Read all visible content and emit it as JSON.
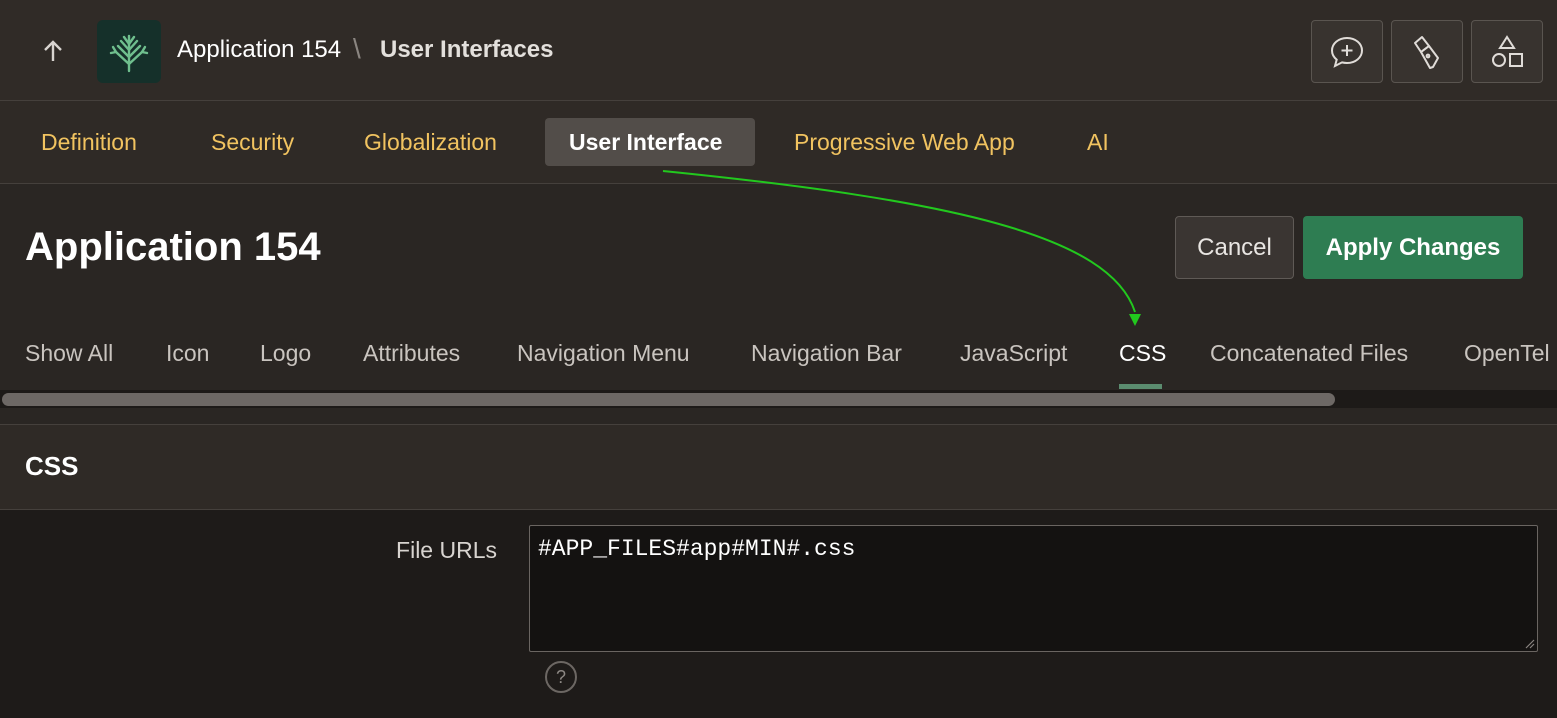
{
  "header": {
    "up_icon": "arrow-up-icon",
    "logo_icon": "tree-logo-icon",
    "app_name": "Application 154",
    "separator": "\\",
    "current_page": "User Interfaces",
    "tools": [
      "add-comment-icon",
      "flashlight-icon",
      "shapes-icon"
    ]
  },
  "nav": {
    "tabs": [
      {
        "label": "Definition",
        "active": false
      },
      {
        "label": "Security",
        "active": false
      },
      {
        "label": "Globalization",
        "active": false
      },
      {
        "label": "User Interface",
        "active": true
      },
      {
        "label": "Progressive Web App",
        "active": false
      },
      {
        "label": "AI",
        "active": false
      }
    ]
  },
  "page": {
    "title": "Application 154",
    "cancel_label": "Cancel",
    "apply_label": "Apply Changes"
  },
  "subtabs": [
    {
      "label": "Show All",
      "active": false
    },
    {
      "label": "Icon",
      "active": false
    },
    {
      "label": "Logo",
      "active": false
    },
    {
      "label": "Attributes",
      "active": false
    },
    {
      "label": "Navigation Menu",
      "active": false
    },
    {
      "label": "Navigation Bar",
      "active": false
    },
    {
      "label": "JavaScript",
      "active": false
    },
    {
      "label": "CSS",
      "active": true
    },
    {
      "label": "Concatenated Files",
      "active": false
    },
    {
      "label": "OpenTel",
      "active": false
    }
  ],
  "region": {
    "title": "CSS",
    "field_label": "File URLs",
    "field_value": "#APP_FILES#app#MIN#.css",
    "help_icon": "help-icon",
    "help_glyph": "?"
  },
  "colors": {
    "accent_gold": "#f1c360",
    "apply_green": "#2e7d52",
    "annotation_arrow": "#22c81e"
  }
}
